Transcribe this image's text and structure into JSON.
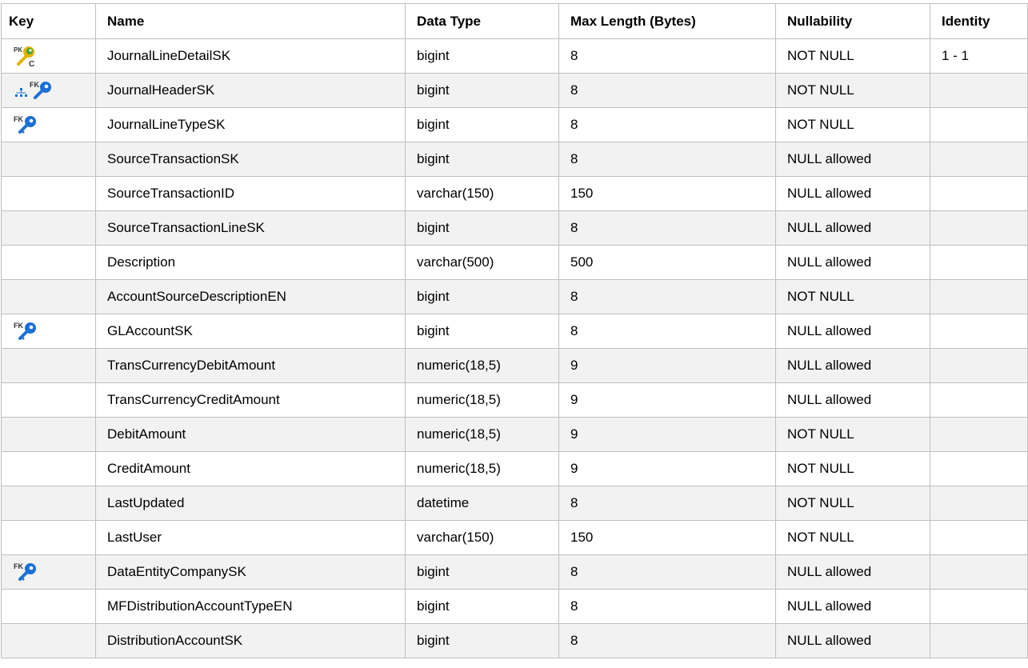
{
  "columns": {
    "key": "Key",
    "name": "Name",
    "data_type": "Data Type",
    "max_length": "Max Length (Bytes)",
    "nullability": "Nullability",
    "identity": "Identity"
  },
  "rows": [
    {
      "key_icon": "pk-fk-clustered-key-icon",
      "name": "JournalLineDetailSK",
      "data_type": "bigint",
      "max_length": "8",
      "nullability": "NOT NULL",
      "identity": "1 - 1"
    },
    {
      "key_icon": "hierarchy-fk-key-icon",
      "name": "JournalHeaderSK",
      "data_type": "bigint",
      "max_length": "8",
      "nullability": "NOT NULL",
      "identity": ""
    },
    {
      "key_icon": "fk-key-icon",
      "name": "JournalLineTypeSK",
      "data_type": "bigint",
      "max_length": "8",
      "nullability": "NOT NULL",
      "identity": ""
    },
    {
      "key_icon": "",
      "name": "SourceTransactionSK",
      "data_type": "bigint",
      "max_length": "8",
      "nullability": "NULL allowed",
      "identity": ""
    },
    {
      "key_icon": "",
      "name": "SourceTransactionID",
      "data_type": "varchar(150)",
      "max_length": "150",
      "nullability": "NULL allowed",
      "identity": ""
    },
    {
      "key_icon": "",
      "name": "SourceTransactionLineSK",
      "data_type": "bigint",
      "max_length": "8",
      "nullability": "NULL allowed",
      "identity": ""
    },
    {
      "key_icon": "",
      "name": "Description",
      "data_type": "varchar(500)",
      "max_length": "500",
      "nullability": "NULL allowed",
      "identity": ""
    },
    {
      "key_icon": "",
      "name": "AccountSourceDescriptionEN",
      "data_type": "bigint",
      "max_length": "8",
      "nullability": "NOT NULL",
      "identity": ""
    },
    {
      "key_icon": "fk-key-icon",
      "name": "GLAccountSK",
      "data_type": "bigint",
      "max_length": "8",
      "nullability": "NULL allowed",
      "identity": ""
    },
    {
      "key_icon": "",
      "name": "TransCurrencyDebitAmount",
      "data_type": "numeric(18,5)",
      "max_length": "9",
      "nullability": "NULL allowed",
      "identity": ""
    },
    {
      "key_icon": "",
      "name": "TransCurrencyCreditAmount",
      "data_type": "numeric(18,5)",
      "max_length": "9",
      "nullability": "NULL allowed",
      "identity": ""
    },
    {
      "key_icon": "",
      "name": "DebitAmount",
      "data_type": "numeric(18,5)",
      "max_length": "9",
      "nullability": "NOT NULL",
      "identity": ""
    },
    {
      "key_icon": "",
      "name": "CreditAmount",
      "data_type": "numeric(18,5)",
      "max_length": "9",
      "nullability": "NOT NULL",
      "identity": ""
    },
    {
      "key_icon": "",
      "name": "LastUpdated",
      "data_type": "datetime",
      "max_length": "8",
      "nullability": "NOT NULL",
      "identity": ""
    },
    {
      "key_icon": "",
      "name": "LastUser",
      "data_type": "varchar(150)",
      "max_length": "150",
      "nullability": "NOT NULL",
      "identity": ""
    },
    {
      "key_icon": "fk-key-icon",
      "name": "DataEntityCompanySK",
      "data_type": "bigint",
      "max_length": "8",
      "nullability": "NULL allowed",
      "identity": ""
    },
    {
      "key_icon": "",
      "name": "MFDistributionAccountTypeEN",
      "data_type": "bigint",
      "max_length": "8",
      "nullability": "NULL allowed",
      "identity": ""
    },
    {
      "key_icon": "",
      "name": "DistributionAccountSK",
      "data_type": "bigint",
      "max_length": "8",
      "nullability": "NULL allowed",
      "identity": ""
    }
  ],
  "colors": {
    "fk_key_blue": "#1c6fd6",
    "pk_key_yellow": "#e2b400",
    "key_green": "#3aa63a",
    "row_alt": "#f2f2f2",
    "grid": "#bfbfbf"
  }
}
